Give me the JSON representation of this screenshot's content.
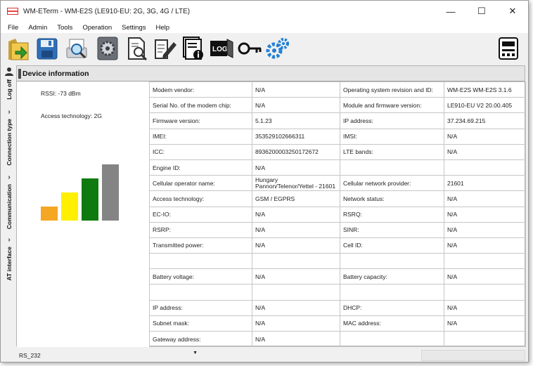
{
  "window": {
    "title": "WM-ETerm - WM-E2S (LE910-EU: 2G, 3G, 4G / LTE)",
    "minimize": "—",
    "maximize": "☐",
    "close": "✕"
  },
  "menu": [
    "File",
    "Admin",
    "Tools",
    "Operation",
    "Settings",
    "Help"
  ],
  "toolbar": {
    "icons": [
      "open-folder-icon",
      "save-disk-icon",
      "search-device-icon",
      "settings-cog-icon",
      "document-search-icon",
      "edit-document-icon",
      "device-info-icon",
      "log-icon",
      "key-icon",
      "gears-icon",
      "meter-device-icon"
    ]
  },
  "sidebar": {
    "tabs": [
      "Log off",
      "Connection type",
      "Communication",
      "AT interface"
    ]
  },
  "panel": {
    "title": "Device information"
  },
  "signal": {
    "rssi_text": "RSSI: -73 dBm",
    "tech_text": "Access technology: 2G",
    "bars": [
      {
        "level": 0.2,
        "color": "#f5a623"
      },
      {
        "level": 0.4,
        "color": "#ffef00"
      },
      {
        "level": 0.6,
        "color": "#0f7a0f"
      },
      {
        "level": 0.8,
        "color": "#848484"
      }
    ]
  },
  "rows": [
    [
      "Modem vendor:",
      "N/A",
      "Operating system revision and ID:",
      "WM-E2S WM-E2S 3.1.6"
    ],
    [
      "Serial No. of the modem chip:",
      "N/A",
      "Module and firmware version:",
      "LE910-EU V2 20.00.405"
    ],
    [
      "Firmware version:",
      "5.1.23",
      "IP address:",
      "37.234.69.215"
    ],
    [
      "IMEI:",
      "353529102666311",
      "IMSI:",
      "N/A"
    ],
    [
      "ICC:",
      "8936200003250172672",
      "LTE bands:",
      "N/A"
    ],
    [
      "Engine ID:",
      "N/A",
      "",
      ""
    ],
    [
      "Cellular operator name:",
      "Hungary Pannon/Telenor/Yettel - 21601",
      "Cellular network provider:",
      "21601"
    ],
    [
      "Access technology:",
      "GSM / EGPRS",
      "Network status:",
      "N/A"
    ],
    [
      "EC-IO:",
      "N/A",
      "RSRQ:",
      "N/A"
    ],
    [
      "RSRP:",
      "N/A",
      "SINR:",
      "N/A"
    ],
    [
      "Transmitted power:",
      "N/A",
      "Cell ID:",
      "N/A"
    ],
    [
      "",
      "",
      "",
      ""
    ],
    [
      "Battery voltage:",
      "N/A",
      "Battery capacity:",
      "N/A"
    ],
    [
      "",
      "",
      "",
      ""
    ],
    [
      "IP address:",
      "N/A",
      "DHCP:",
      "N/A"
    ],
    [
      "Subnet mask:",
      "N/A",
      "MAC address:",
      "N/A"
    ],
    [
      "Gateway address:",
      "N/A",
      "",
      ""
    ]
  ],
  "status": {
    "port": "RS_232",
    "port_arrow": "▼"
  }
}
